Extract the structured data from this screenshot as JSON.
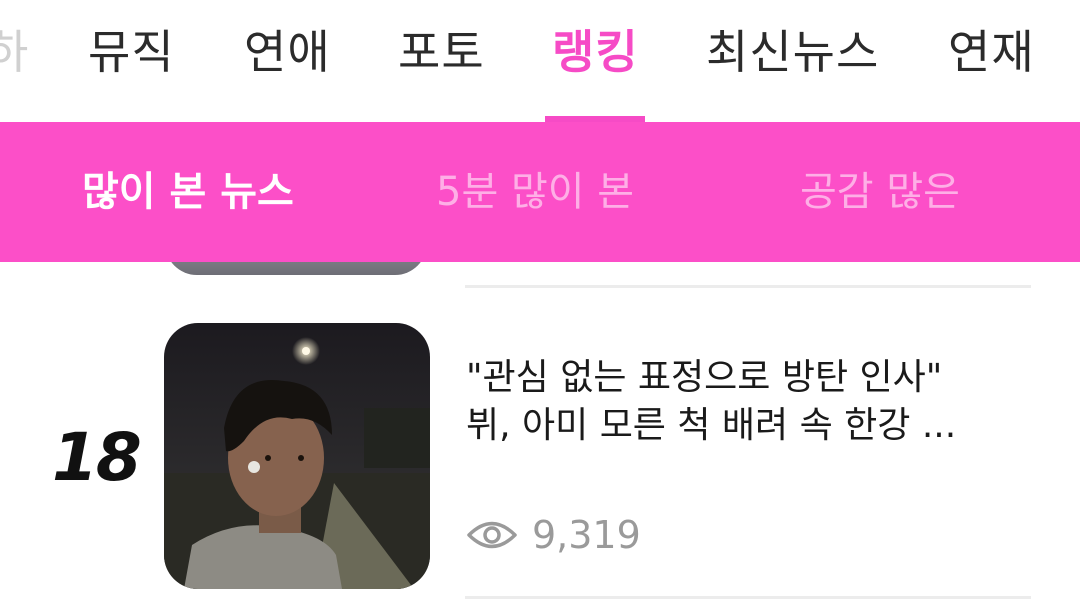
{
  "top_nav": {
    "items": [
      {
        "label": "뮤직"
      },
      {
        "label": "연애"
      },
      {
        "label": "포토"
      },
      {
        "label": "랭킹"
      },
      {
        "label": "최신뉴스"
      },
      {
        "label": "연재"
      }
    ],
    "active": "랭킹"
  },
  "sub_tabs": {
    "items": [
      {
        "label": "많이 본 뉴스"
      },
      {
        "label": "5분 많이 본"
      },
      {
        "label": "공감 많은"
      }
    ],
    "active": "많이 본 뉴스"
  },
  "article": {
    "rank": "18",
    "headline_line1": "\"관심 없는 표정으로 방탄 인사\"",
    "headline_line2": "뷔, 아미 모른 척 배려 속 한강 ...",
    "views": "9,319"
  },
  "colors": {
    "accent": "#f64bc6",
    "tab_bar": "#fc4fc8",
    "text": "#1a1a1a",
    "muted": "#9a9a9a"
  },
  "icons": {
    "views": "eye-icon"
  }
}
